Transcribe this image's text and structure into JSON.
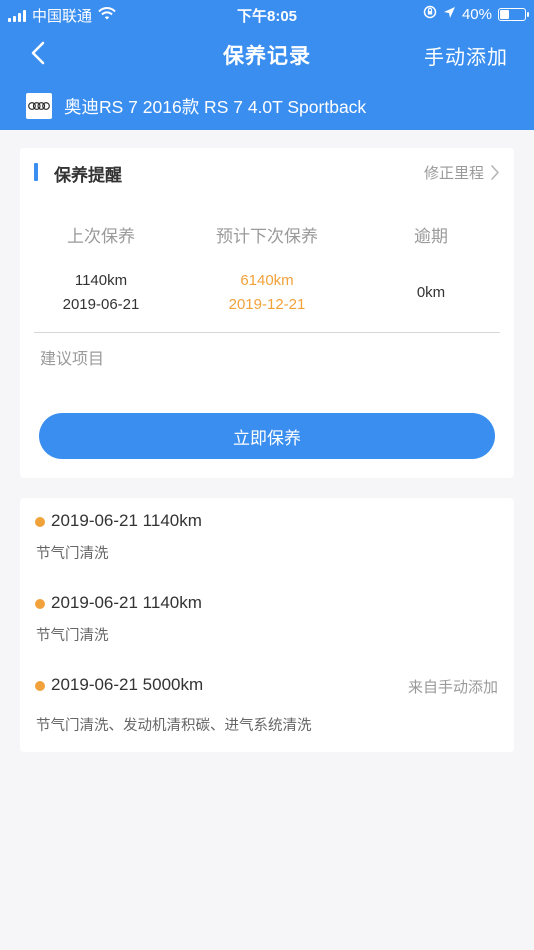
{
  "status_bar": {
    "carrier": "中国联通",
    "time": "下午8:05",
    "battery_percent_text": "40%",
    "battery_level": 0.4
  },
  "nav": {
    "back_icon": "chevron-left-icon",
    "title": "保养记录",
    "manual_add_label": "手动添加"
  },
  "car": {
    "logo_icon": "audi-rings-icon",
    "name": "奥迪RS 7 2016款 RS 7 4.0T Sportback"
  },
  "reminder": {
    "title": "保养提醒",
    "edit_mileage_label": "修正里程",
    "last_maintenance": {
      "label": "上次保养",
      "mileage": "1140km",
      "date": "2019-06-21"
    },
    "next_maintenance": {
      "label": "预计下次保养",
      "mileage": "6140km",
      "date": "2019-12-21"
    },
    "overdue": {
      "label": "逾期",
      "mileage": "0km"
    },
    "suggested_items_label": "建议项目",
    "maintain_now_label": "立即保养"
  },
  "records": [
    {
      "title": "2019-06-21 1140km",
      "items": "节气门清洗",
      "source": ""
    },
    {
      "title": "2019-06-21 1140km",
      "items": "节气门清洗",
      "source": ""
    },
    {
      "title": "2019-06-21 5000km",
      "items": "节气门清洗、发动机清积碳、进气系统清洗",
      "source": "来自手动添加"
    }
  ],
  "colors": {
    "brand_blue": "#3a8ef0",
    "accent_orange": "#f2a23a",
    "background": "#f6f6f8"
  }
}
